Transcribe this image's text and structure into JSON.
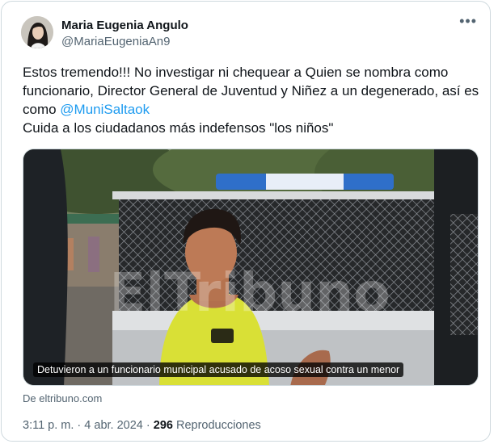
{
  "author": {
    "name": "Maria Eugenia Angulo",
    "handle": "@MariaEugeniaAn9"
  },
  "more_icon": "more-horizontal-icon",
  "tweet": {
    "line1": "Estos tremendo!!! No investigar ni chequear a Quien se nombra como funcionario, Director General de Juventud y Niñez a un degenerado, así es como ",
    "mention": "@MuniSaltaok",
    "line2": "Cuida a los ciudadanos más indefensos \"los niños\""
  },
  "media": {
    "caption": "Detuvieron a un funcionario municipal acusado de acoso sexual contra un menor",
    "watermark": "ElTribuno"
  },
  "link_source": "De eltribuno.com",
  "meta": {
    "time_date": "3:11 p. m. · 4 abr. 2024 · ",
    "views_count": "296",
    "views_label": " Reproducciones"
  },
  "colors": {
    "link": "#1d9bf0",
    "secondary_text": "#536471",
    "border": "#cfd9de"
  }
}
